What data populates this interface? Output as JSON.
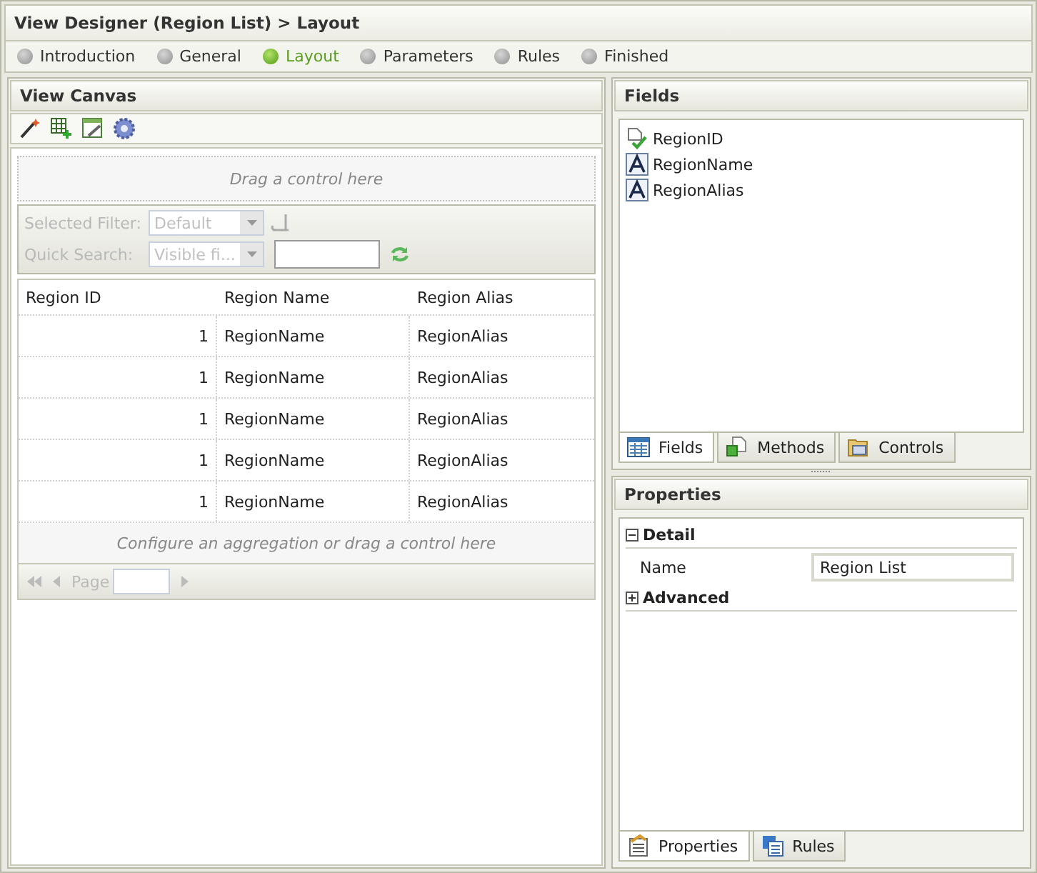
{
  "window": {
    "title": "View Designer (Region List) > Layout"
  },
  "steps": [
    {
      "label": "Introduction",
      "selected": false
    },
    {
      "label": "General",
      "selected": false
    },
    {
      "label": "Layout",
      "selected": true
    },
    {
      "label": "Parameters",
      "selected": false
    },
    {
      "label": "Rules",
      "selected": false
    },
    {
      "label": "Finished",
      "selected": false
    }
  ],
  "canvas": {
    "title": "View Canvas",
    "drop_hint": "Drag a control here",
    "filter_bar": {
      "disabled": true,
      "filter_label": "Selected Filter:",
      "filter_value": "Default",
      "search_label": "Quick Search:",
      "search_value": "Visible fi..."
    },
    "columns": [
      "Region ID",
      "Region Name",
      "Region Alias"
    ],
    "rows": [
      [
        "1",
        "RegionName",
        "RegionAlias"
      ],
      [
        "1",
        "RegionName",
        "RegionAlias"
      ],
      [
        "1",
        "RegionName",
        "RegionAlias"
      ],
      [
        "1",
        "RegionName",
        "RegionAlias"
      ],
      [
        "1",
        "RegionName",
        "RegionAlias"
      ]
    ],
    "footer_hint": "Configure an aggregation or drag a control here",
    "pager": {
      "label": "Page"
    }
  },
  "fields": {
    "title": "Fields",
    "items": [
      {
        "name": "RegionID",
        "kind": "key"
      },
      {
        "name": "RegionName",
        "kind": "text"
      },
      {
        "name": "RegionAlias",
        "kind": "text"
      }
    ],
    "tabs": [
      {
        "label": "Fields",
        "kind": "grid",
        "selected": true
      },
      {
        "label": "Methods",
        "kind": "method",
        "selected": false
      },
      {
        "label": "Controls",
        "kind": "controls",
        "selected": false
      }
    ]
  },
  "properties": {
    "title": "Properties",
    "sections": [
      {
        "label": "Detail",
        "expanded": true,
        "rows": [
          {
            "label": "Name",
            "value": "Region List"
          }
        ]
      },
      {
        "label": "Advanced",
        "expanded": false
      }
    ],
    "tabs": [
      {
        "label": "Properties",
        "kind": "props",
        "selected": true
      },
      {
        "label": "Rules",
        "kind": "rules",
        "selected": false
      }
    ]
  }
}
